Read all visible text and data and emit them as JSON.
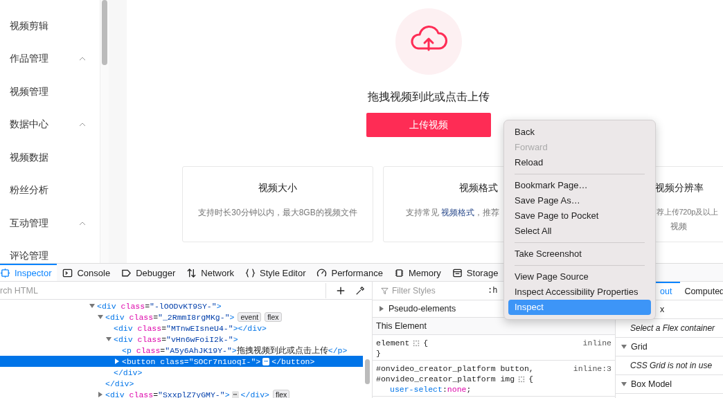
{
  "sidebar": {
    "items": [
      {
        "label": "视频剪辑"
      },
      {
        "label": "作品管理",
        "expanded": true,
        "children": [
          {
            "label": "视频管理"
          }
        ]
      },
      {
        "label": "数据中心",
        "expanded": true,
        "children": [
          {
            "label": "视频数据"
          },
          {
            "label": "粉丝分析"
          }
        ]
      },
      {
        "label": "互动管理",
        "expanded": true,
        "children": [
          {
            "label": "评论管理"
          }
        ]
      }
    ]
  },
  "upload": {
    "prompt": "拖拽视频到此或点击上传",
    "button": "上传视频"
  },
  "cards": [
    {
      "title": "视频大小",
      "text": "支持时长30分钟以内，最大8GB的视频文件"
    },
    {
      "title": "视频格式",
      "text": "支持常见 **视频格式**，推荐"
    },
    {
      "title": "视频分辨率",
      "text": "荐上传720p及以上",
      "text2": "视频"
    }
  ],
  "devtools": {
    "tabs": [
      {
        "label": "Inspector",
        "selected": true
      },
      {
        "label": "Console",
        "selected": false
      },
      {
        "label": "Debugger",
        "selected": false
      },
      {
        "label": "Network",
        "selected": false
      },
      {
        "label": "Style Editor",
        "selected": false
      },
      {
        "label": "Performance",
        "selected": false
      },
      {
        "label": "Memory",
        "selected": false
      },
      {
        "label": "Storage",
        "selected": false
      }
    ],
    "search_placeholder": "rch HTML",
    "tree": [
      {
        "expanded": true,
        "selected": false,
        "parts": [
          {
            "kind": "tag",
            "text": "<div"
          },
          {
            "kind": "attr",
            "text": "class"
          },
          {
            "kind": "punct",
            "text": "="
          },
          {
            "kind": "value",
            "text": "\"-lOODvKT9SY-\""
          },
          {
            "kind": "tag",
            "text": ">"
          }
        ],
        "children": [
          {
            "expanded": true,
            "selected": false,
            "parts": [
              {
                "kind": "tag",
                "text": "<div"
              },
              {
                "kind": "attr",
                "text": "class"
              },
              {
                "kind": "punct",
                "text": "="
              },
              {
                "kind": "value",
                "text": "\"_2RmmI8rgMKg-\""
              },
              {
                "kind": "tag",
                "text": ">"
              }
            ],
            "badges": [
              "event",
              "flex"
            ],
            "children": [
              {
                "selected": false,
                "parts": [
                  {
                    "kind": "tag",
                    "text": "<div"
                  },
                  {
                    "kind": "attr",
                    "text": "class"
                  },
                  {
                    "kind": "punct",
                    "text": "="
                  },
                  {
                    "kind": "value",
                    "text": "\"MTnwEIsneU4-\""
                  },
                  {
                    "kind": "tag",
                    "text": "></div>"
                  }
                ]
              },
              {
                "expanded": true,
                "selected": false,
                "parts": [
                  {
                    "kind": "tag",
                    "text": "<div"
                  },
                  {
                    "kind": "attr",
                    "text": "class"
                  },
                  {
                    "kind": "punct",
                    "text": "="
                  },
                  {
                    "kind": "value",
                    "text": "\"vHn6wFoiI2k-\""
                  },
                  {
                    "kind": "tag",
                    "text": ">"
                  }
                ],
                "children": [
                  {
                    "selected": false,
                    "parts": [
                      {
                        "kind": "tag",
                        "text": "<p"
                      },
                      {
                        "kind": "attr",
                        "text": "class"
                      },
                      {
                        "kind": "punct",
                        "text": "="
                      },
                      {
                        "kind": "value",
                        "text": "\"A5y6AhJK19Y-\""
                      },
                      {
                        "kind": "tag",
                        "text": ">"
                      },
                      {
                        "kind": "text",
                        "text": "拖拽视频到此或点击上传"
                      },
                      {
                        "kind": "tag",
                        "text": "</p>"
                      }
                    ]
                  },
                  {
                    "expanded": false,
                    "selected": true,
                    "parts": [
                      {
                        "kind": "tag",
                        "text": "<button"
                      },
                      {
                        "kind": "attr",
                        "text": "class"
                      },
                      {
                        "kind": "punct",
                        "text": "="
                      },
                      {
                        "kind": "value",
                        "text": "\"SOCr7n1uoqI-\""
                      },
                      {
                        "kind": "tag",
                        "text": ">"
                      },
                      {
                        "kind": "more",
                        "text": "⋯"
                      },
                      {
                        "kind": "tag",
                        "text": "</button>"
                      }
                    ]
                  }
                ],
                "close": "</div>"
              }
            ],
            "close": "</div>"
          },
          {
            "expanded": false,
            "selected": false,
            "parts": [
              {
                "kind": "tag",
                "text": "<div"
              },
              {
                "kind": "attr",
                "text": "class"
              },
              {
                "kind": "punct",
                "text": "="
              },
              {
                "kind": "value",
                "text": "\"SxxplZ7yGMY-\""
              },
              {
                "kind": "tag",
                "text": ">"
              },
              {
                "kind": "more",
                "text": "⋯"
              },
              {
                "kind": "tag",
                "text": "</div>"
              }
            ],
            "badges": [
              "flex"
            ]
          }
        ]
      }
    ],
    "filter_placeholder": "Filter Styles",
    "pseudo_toggle": ":h",
    "pseudo_elements": "Pseudo-elements",
    "this_element": "This Element",
    "rules": [
      {
        "selectors": [
          "element"
        ],
        "brace": "{",
        "source": "inline",
        "close": "}"
      },
      {
        "selectors": [
          "#onvideo_creator_platform button,",
          "#onvideo_creator_platform img"
        ],
        "brace": "{",
        "source": "inline:3",
        "declarations": [
          {
            "property": "user-select",
            "colon": ":",
            "value": "none",
            "semi": ";"
          }
        ]
      }
    ],
    "side_tabs": [
      {
        "label": "out",
        "selected": true
      },
      {
        "label": "Computed",
        "selected": false
      }
    ],
    "layout_sections": [
      {
        "kind": "header",
        "label": "x"
      },
      {
        "kind": "note",
        "label": "Select a Flex container"
      },
      {
        "kind": "header",
        "label": "Grid",
        "expanded": true
      },
      {
        "kind": "note",
        "label": "CSS Grid is not in use"
      },
      {
        "kind": "header",
        "label": "Box Model",
        "expanded": true
      }
    ]
  },
  "context_menu": [
    {
      "kind": "item",
      "label": "Back",
      "disabled": false,
      "selected": false
    },
    {
      "kind": "item",
      "label": "Forward",
      "disabled": true,
      "selected": false
    },
    {
      "kind": "item",
      "label": "Reload",
      "disabled": false,
      "selected": false
    },
    {
      "kind": "separator"
    },
    {
      "kind": "item",
      "label": "Bookmark Page…",
      "disabled": false,
      "selected": false
    },
    {
      "kind": "item",
      "label": "Save Page As…",
      "disabled": false,
      "selected": false
    },
    {
      "kind": "item",
      "label": "Save Page to Pocket",
      "disabled": false,
      "selected": false
    },
    {
      "kind": "item",
      "label": "Select All",
      "disabled": false,
      "selected": false
    },
    {
      "kind": "separator"
    },
    {
      "kind": "item",
      "label": "Take Screenshot",
      "disabled": false,
      "selected": false
    },
    {
      "kind": "separator"
    },
    {
      "kind": "item",
      "label": "View Page Source",
      "disabled": false,
      "selected": false
    },
    {
      "kind": "item",
      "label": "Inspect Accessibility Properties",
      "disabled": false,
      "selected": false
    },
    {
      "kind": "item",
      "label": "Inspect",
      "disabled": false,
      "selected": true
    }
  ]
}
